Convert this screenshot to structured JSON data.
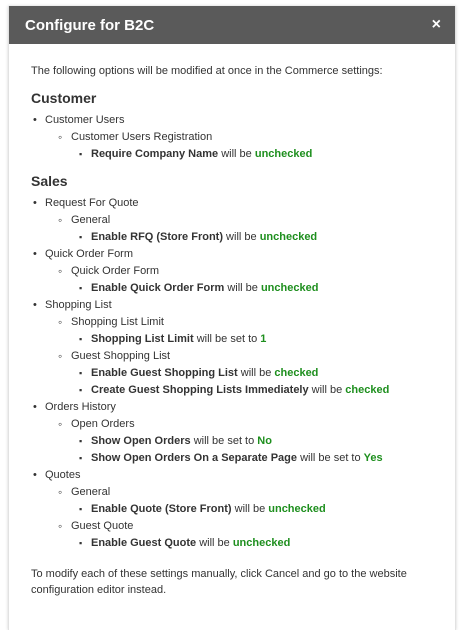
{
  "dialog": {
    "title": "Configure for B2C",
    "close_icon": "×",
    "intro": "The following options will be modified at once in the Commerce settings:",
    "footer": "To modify each of these settings manually, click Cancel and go to the website configuration editor instead."
  },
  "sections": [
    {
      "title": "Customer",
      "groups": [
        {
          "label": "Customer Users",
          "subgroups": [
            {
              "label": "Customer Users Registration",
              "options": [
                {
                  "name": "Require Company Name",
                  "action": " will be ",
                  "value": "unchecked"
                }
              ]
            }
          ]
        }
      ]
    },
    {
      "title": "Sales",
      "groups": [
        {
          "label": "Request For Quote",
          "subgroups": [
            {
              "label": "General",
              "options": [
                {
                  "name": "Enable RFQ (Store Front)",
                  "action": " will be ",
                  "value": "unchecked"
                }
              ]
            }
          ]
        },
        {
          "label": "Quick Order Form",
          "subgroups": [
            {
              "label": "Quick Order Form",
              "options": [
                {
                  "name": "Enable Quick Order Form",
                  "action": " will be ",
                  "value": "unchecked"
                }
              ]
            }
          ]
        },
        {
          "label": "Shopping List",
          "subgroups": [
            {
              "label": "Shopping List Limit",
              "options": [
                {
                  "name": "Shopping List Limit",
                  "action": " will be set to ",
                  "value": "1"
                }
              ]
            },
            {
              "label": "Guest Shopping List",
              "options": [
                {
                  "name": "Enable Guest Shopping List",
                  "action": " will be ",
                  "value": "checked"
                },
                {
                  "name": "Create Guest Shopping Lists Immediately",
                  "action": " will be ",
                  "value": "checked"
                }
              ]
            }
          ]
        },
        {
          "label": "Orders History",
          "subgroups": [
            {
              "label": "Open Orders",
              "options": [
                {
                  "name": "Show Open Orders",
                  "action": " will be set to ",
                  "value": "No"
                },
                {
                  "name": "Show Open Orders On a Separate Page",
                  "action": " will be set to ",
                  "value": "Yes"
                }
              ]
            }
          ]
        },
        {
          "label": "Quotes",
          "subgroups": [
            {
              "label": "General",
              "options": [
                {
                  "name": "Enable Quote (Store Front)",
                  "action": " will be ",
                  "value": "unchecked"
                }
              ]
            },
            {
              "label": "Guest Quote",
              "options": [
                {
                  "name": "Enable Guest Quote",
                  "action": " will be ",
                  "value": "unchecked"
                }
              ]
            }
          ]
        }
      ]
    }
  ]
}
